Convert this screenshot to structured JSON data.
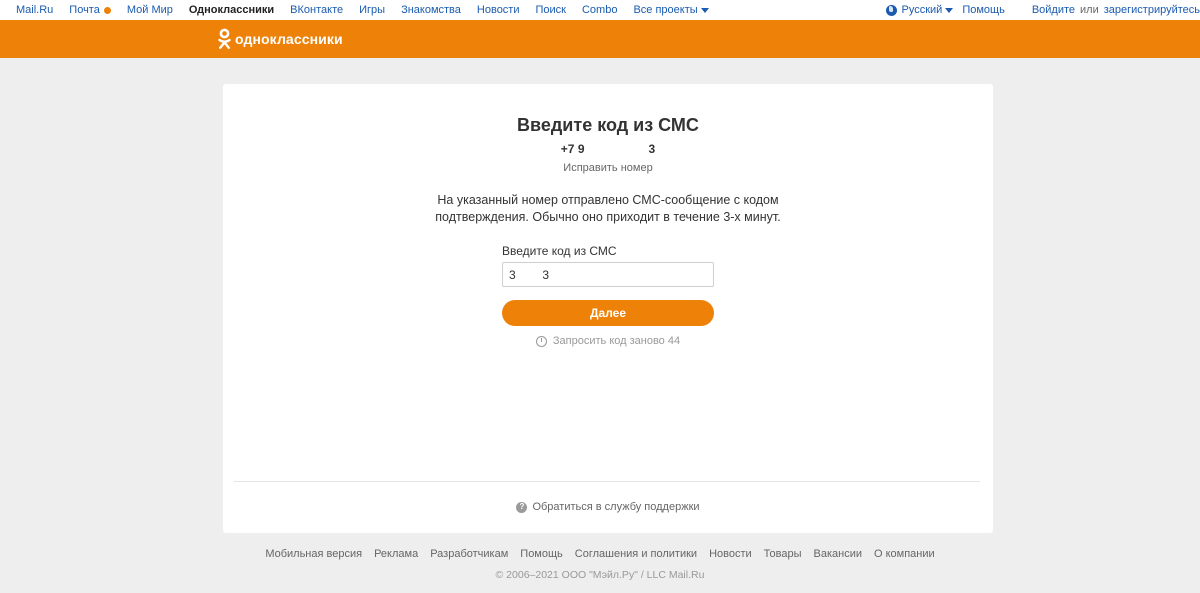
{
  "topbar": {
    "links": [
      {
        "label": "Mail.Ru"
      },
      {
        "label": "Почта"
      },
      {
        "label": "Мой Мир"
      },
      {
        "label": "Одноклассники"
      },
      {
        "label": "ВКонтакте"
      },
      {
        "label": "Игры"
      },
      {
        "label": "Знакомства"
      },
      {
        "label": "Новости"
      },
      {
        "label": "Поиск"
      },
      {
        "label": "Combo"
      },
      {
        "label": "Все проекты"
      }
    ],
    "language": "Русский",
    "help": "Помощь",
    "login": "Войдите",
    "or": "или",
    "register": "зарегистрируйтесь"
  },
  "header": {
    "logo_text": "одноклассники"
  },
  "card": {
    "title": "Введите код из СМС",
    "phone_prefix": "+7 9",
    "phone_suffix": "3",
    "fix_number": "Исправить номер",
    "description": "На указанный номер отправлено СМС-сообщение с кодом подтверждения. Обычно оно приходит в течение 3-х минут.",
    "code_label": "Введите код из СМС",
    "code_value": "3        3",
    "next_button": "Далее",
    "resend_text": "Запросить код заново 44",
    "support": "Обратиться в службу поддержки"
  },
  "footer": {
    "links": [
      {
        "label": "Мобильная версия"
      },
      {
        "label": "Реклама"
      },
      {
        "label": "Разработчикам"
      },
      {
        "label": "Помощь"
      },
      {
        "label": "Соглашения и политики"
      },
      {
        "label": "Новости"
      },
      {
        "label": "Товары"
      },
      {
        "label": "Вакансии"
      },
      {
        "label": "О компании"
      }
    ],
    "copyright": "© 2006–2021 ООО \"Мэйл.Ру\" / LLC Mail.Ru"
  },
  "colors": {
    "brand_orange": "#ee8208",
    "link_blue": "#1a5bb0",
    "page_bg": "#eeeeee"
  },
  "icons": [
    "mail-notification-dot",
    "chevron-down-icon",
    "globe-icon",
    "ok-logo-icon",
    "clock-icon",
    "help-icon"
  ]
}
